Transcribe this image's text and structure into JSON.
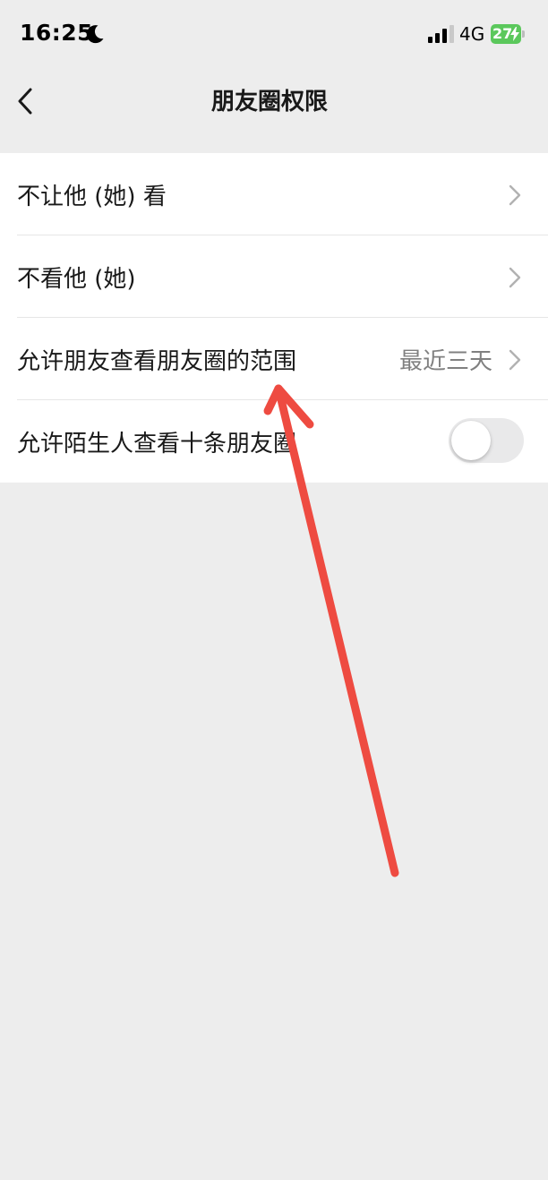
{
  "status_bar": {
    "time": "16:25",
    "network": "4G",
    "battery": "27",
    "icons": [
      "moon-icon",
      "signal-icon",
      "battery-charging-icon"
    ]
  },
  "nav": {
    "title": "朋友圈权限",
    "back_icon": "chevron-left-icon"
  },
  "settings": {
    "items": [
      {
        "label": "不让他 (她) 看",
        "type": "link"
      },
      {
        "label": "不看他 (她)",
        "type": "link"
      },
      {
        "label": "允许朋友查看朋友圈的范围",
        "value": "最近三天",
        "type": "link"
      },
      {
        "label": "允许陌生人查看十条朋友圈",
        "type": "toggle",
        "enabled": false
      }
    ]
  },
  "annotation": {
    "icon": "red-arrow-icon",
    "color": "#ee4b41"
  },
  "colors": {
    "background": "#ededed",
    "list_background": "#ffffff",
    "text_primary": "#191919",
    "text_secondary": "#808080",
    "battery_green": "#5bc85c",
    "annotation_red": "#ee4b41"
  }
}
